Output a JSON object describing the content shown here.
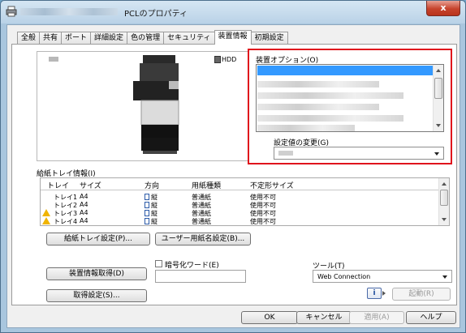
{
  "window": {
    "title": "PCLのプロパティ",
    "close_label": "x"
  },
  "tabs": [
    "全般",
    "共有",
    "ポート",
    "詳細設定",
    "色の管理",
    "セキュリティ",
    "装置情報",
    "初期設定"
  ],
  "active_tab": 6,
  "preview": {
    "hdd_label": "HDD",
    "tray_numbers": [
      "1",
      "2"
    ]
  },
  "device_options": {
    "label": "装置オプション(O)",
    "setting_change_label": "設定値の変更(G)"
  },
  "paper_tray_info": {
    "label": "給紙トレイ情報(I)",
    "columns": [
      "トレイ",
      "サイズ",
      "方向",
      "用紙種類",
      "不定形サイズ"
    ],
    "rows": [
      {
        "tray": "トレイ1",
        "size": "A4",
        "orientation": "縦",
        "paper_type": "普通紙",
        "custom_size": "使用不可",
        "warning": false
      },
      {
        "tray": "トレイ2",
        "size": "A4",
        "orientation": "縦",
        "paper_type": "普通紙",
        "custom_size": "使用不可",
        "warning": false
      },
      {
        "tray": "トレイ3",
        "size": "A4",
        "orientation": "縦",
        "paper_type": "普通紙",
        "custom_size": "使用不可",
        "warning": true
      },
      {
        "tray": "トレイ4",
        "size": "A4",
        "orientation": "縦",
        "paper_type": "普通紙",
        "custom_size": "使用不可",
        "warning": true
      }
    ]
  },
  "buttons": {
    "tray_settings": "給紙トレイ設定(P)...",
    "user_paper_name": "ユーザー用紙名設定(B)...",
    "get_device_info": "装置情報取得(D)",
    "get_settings": "取得設定(S)...",
    "launch": "起動(R)",
    "ok": "OK",
    "cancel": "キャンセル",
    "apply": "適用(A)",
    "help": "ヘルプ"
  },
  "encryption": {
    "label": "暗号化ワード(E)",
    "checked": false,
    "value": ""
  },
  "tools": {
    "label": "ツール(T)",
    "selected": "Web Connection"
  },
  "colors": {
    "highlight_border": "#e0141c",
    "selection_blue": "#3399ff",
    "warning_yellow": "#f0b400"
  }
}
